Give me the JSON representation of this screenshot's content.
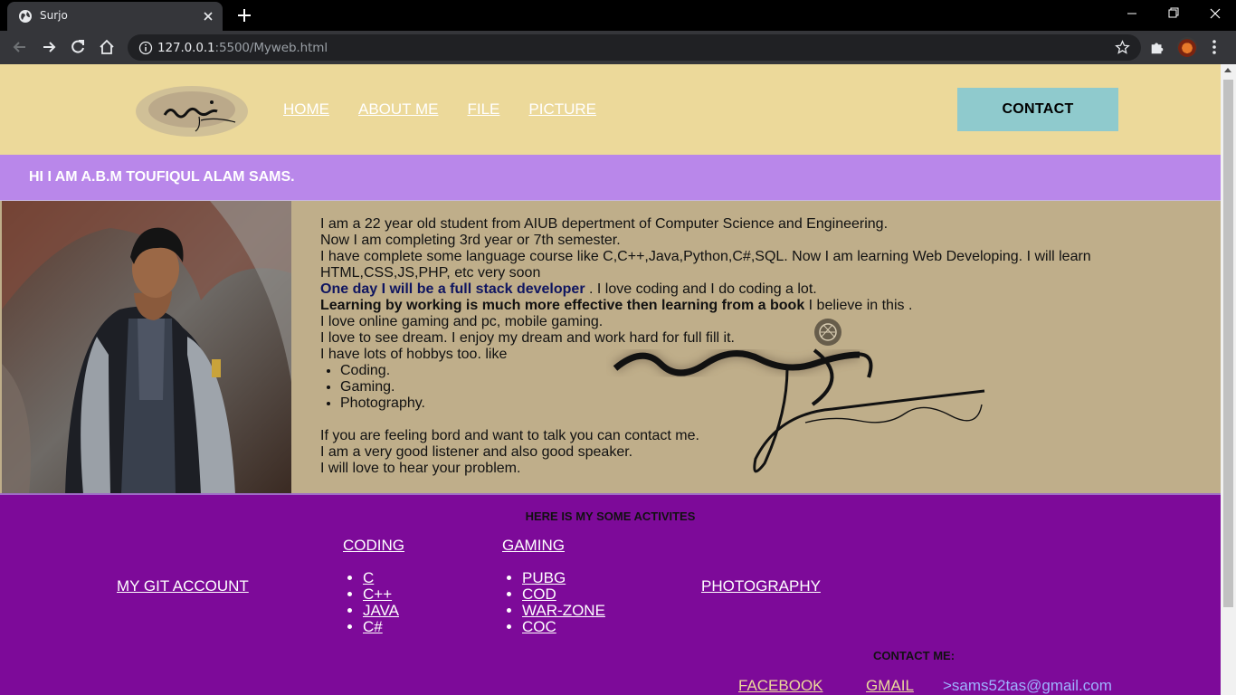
{
  "browser": {
    "tab_title": "Surjo",
    "url_host": "127.0.0.1",
    "url_rest": ":5500/Myweb.html"
  },
  "header": {
    "nav": [
      "HOME",
      "ABOUT ME",
      "FILE",
      "PICTURE"
    ],
    "contact_button": "CONTACT"
  },
  "greeting": "HI I AM A.B.M TOUFIQUL ALAM SAMS.",
  "about": {
    "line1": "I am a 22 year old student from AIUB depertment of Computer Science and Engineering.",
    "line2": "Now I am completing 3rd year or 7th semester.",
    "line3": "I have complete some language course like C,C++,Java,Python,C#,SQL. Now I am learning Web Developing. I will learn HTML,CSS,JS,PHP, etc very soon",
    "line4_bold": "One day I will be a full stack developer",
    "line4_rest": " . I love coding and I do coding a lot.",
    "line5_bold": "Learning by working is much more effective then learning from a book",
    "line5_rest": " I believe in this .",
    "line6": "I love online gaming and pc, mobile gaming.",
    "line7": "I love to see dream. I enjoy my dream and work hard for full fill it.",
    "line8": "I have lots of hobbys too. like",
    "hobbies": [
      "Coding.",
      "Gaming.",
      "Photography."
    ],
    "line9": "If you are feeling bord and want to talk you can contact me.",
    "line10": "I am a very good listener and also good speaker.",
    "line11": "I will love to hear your problem."
  },
  "activities": {
    "heading": "HERE IS MY SOME ACTIVITES",
    "git": "MY GIT ACCOUNT",
    "coding_title": "CODING",
    "coding_items": [
      "C",
      "C++",
      "JAVA",
      "C#"
    ],
    "gaming_title": "GAMING",
    "gaming_items": [
      "PUBG",
      "COD",
      "WAR-ZONE",
      "COC"
    ],
    "photography": "PHOTOGRAPHY",
    "contact_label": "CONTACT ME:",
    "facebook": "FACEBOOK",
    "gmail": "GMAIL",
    "email": ">sams52tas@gmail.com"
  }
}
